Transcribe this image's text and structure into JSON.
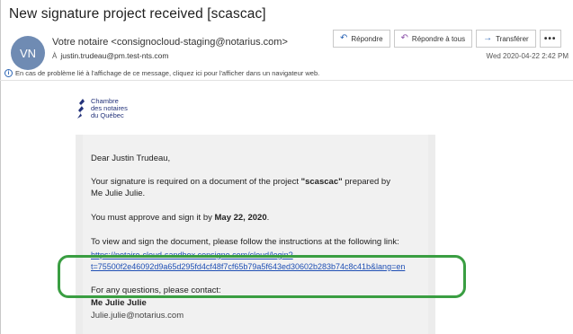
{
  "email": {
    "subject": "New signature project received [scascac]",
    "avatar_initials": "VN",
    "from": "Votre notaire <consignocloud-staging@notarius.com>",
    "to_label": "À",
    "to": "justin.trudeau@pm.test-nts.com",
    "date": "Wed 2020-04-22 2:42 PM",
    "info_message": "En cas de problème lié à l'affichage de ce message, cliquez ici pour l'afficher dans un navigateur web."
  },
  "actions": {
    "reply": {
      "label": "Répondre",
      "icon": "reply-icon"
    },
    "reply_all": {
      "label": "Répondre à tous",
      "icon": "reply-all-icon"
    },
    "forward": {
      "label": "Transférer",
      "icon": "forward-icon"
    },
    "more": {
      "label": "•••",
      "icon": "more-icon"
    }
  },
  "logo": {
    "line1": "Chambre",
    "line2": "des notaires",
    "line3": "du Québec"
  },
  "body": {
    "greeting": "Dear Justin Trudeau,",
    "para1_pre": "Your signature is required on a document of the project ",
    "para1_project": "\"scascac\"",
    "para1_post": " prepared by",
    "para1_line2": "Me Julie Julie.",
    "para2_pre": "You must approve and sign it by ",
    "para2_date": "May 22, 2020",
    "para2_post": ".",
    "para3": "To view and sign the document, please follow the instructions at the following link:",
    "link_line1": "https://notaire-cloud-sandbox.consigno.com/cloud/login?",
    "link_line2": "t=75500f2e46092d9a65d295fd4cf48f7cf65b79a5f643ed30602b283b74c8c41b&lang=en",
    "para4": "For any questions, please contact:",
    "contact_name": "Me Julie Julie",
    "contact_email": "Julie.julie@notarius.com"
  },
  "colors": {
    "accent": "#2a64b4",
    "highlight": "#3a9e42",
    "link": "#1f4fb4",
    "avatar": "#6f8bb3"
  }
}
